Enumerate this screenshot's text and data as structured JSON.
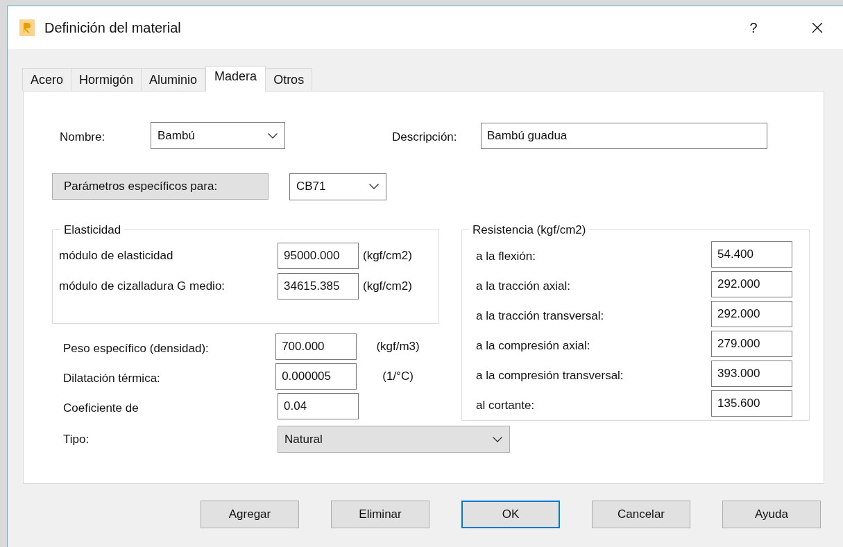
{
  "window": {
    "title": "Definición del material",
    "help": "?"
  },
  "tabs": [
    {
      "label": "Acero",
      "selected": false
    },
    {
      "label": "Hormigón",
      "selected": false
    },
    {
      "label": "Aluminio",
      "selected": false
    },
    {
      "label": "Madera",
      "selected": true
    },
    {
      "label": "Otros",
      "selected": false
    }
  ],
  "nombre": {
    "label": "Nombre:",
    "value": "Bambú"
  },
  "descripcion": {
    "label": "Descripción:",
    "value": "Bambú guadua"
  },
  "parametros": {
    "button": "Parámetros específicos para:",
    "value": "CB71"
  },
  "elasticidad": {
    "title": "Elasticidad",
    "rows": [
      {
        "label": "módulo de elasticidad",
        "value": "95000.000",
        "unit": "(kgf/cm2)"
      },
      {
        "label": "módulo de cizalladura G medio:",
        "value": "34615.385",
        "unit": "(kgf/cm2)"
      }
    ]
  },
  "properties": [
    {
      "label": "Peso específico (densidad):",
      "value": "700.000",
      "unit": "(kgf/m3)"
    },
    {
      "label": "Dilatación térmica:",
      "value": "0.000005",
      "unit": "(1/°C)"
    },
    {
      "label": "Coeficiente de",
      "value": "0.04"
    }
  ],
  "resistencia": {
    "title": "Resistencia (kgf/cm2)",
    "rows": [
      {
        "label": "a la flexión:",
        "value": "54.400"
      },
      {
        "label": "a la tracción axial:",
        "value": "292.000"
      },
      {
        "label": "a la tracción transversal:",
        "value": "292.000"
      },
      {
        "label": "a la compresión axial:",
        "value": "279.000"
      },
      {
        "label": "a la compresión transversal:",
        "value": "393.000"
      },
      {
        "label": "al cortante:",
        "value": "135.600"
      }
    ]
  },
  "tipo": {
    "label": "Tipo:",
    "value": "Natural"
  },
  "buttons": [
    {
      "label": "Agregar",
      "default": false
    },
    {
      "label": "Eliminar",
      "default": false
    },
    {
      "label": "OK",
      "default": true
    },
    {
      "label": "Cancelar",
      "default": false
    },
    {
      "label": "Ayuda",
      "default": false
    }
  ]
}
